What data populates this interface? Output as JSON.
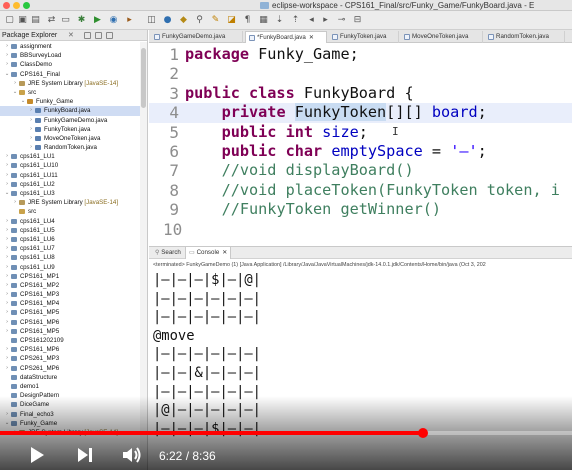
{
  "window": {
    "title": "eclipse-workspace - CPS161_Final/src/Funky_Game/FunkyBoard.java - E"
  },
  "colors": {
    "keyword": "#7f0055",
    "comment": "#3f7f5f",
    "string": "#2a00ff",
    "field": "#0000c0",
    "progress": "#ff0000",
    "selection": "#cfdcf3"
  },
  "explorer": {
    "tab_label": "Package Explorer",
    "close_icon": "✕",
    "items": [
      {
        "label": "assignment",
        "depth": 0,
        "arrow": "›",
        "icon": "project-icon"
      },
      {
        "label": "BBSurveyLoad",
        "depth": 0,
        "arrow": "›",
        "icon": "project-icon"
      },
      {
        "label": "ClassDemo",
        "depth": 0,
        "arrow": "›",
        "icon": "project-icon"
      },
      {
        "label": "CPS161_Final",
        "depth": 0,
        "arrow": "⌄",
        "icon": "project-icon"
      },
      {
        "label": "JRE System Library",
        "deco": "[JavaSE-14]",
        "depth": 1,
        "arrow": "›",
        "icon": "library-icon"
      },
      {
        "label": "src",
        "depth": 1,
        "arrow": "⌄",
        "icon": "source-folder-icon"
      },
      {
        "label": "Funky_Game",
        "depth": 2,
        "arrow": "⌄",
        "icon": "package-icon"
      },
      {
        "label": "FunkyBoard.java",
        "depth": 3,
        "arrow": "›",
        "icon": "java-file-icon",
        "selected": true
      },
      {
        "label": "FunkyGameDemo.java",
        "depth": 3,
        "arrow": "›",
        "icon": "java-file-icon"
      },
      {
        "label": "FunkyToken.java",
        "depth": 3,
        "arrow": "›",
        "icon": "java-file-icon"
      },
      {
        "label": "MoveOneToken.java",
        "depth": 3,
        "arrow": "›",
        "icon": "java-file-icon"
      },
      {
        "label": "RandomToken.java",
        "depth": 3,
        "arrow": "›",
        "icon": "java-file-icon"
      },
      {
        "label": "cps161_LU1",
        "depth": 0,
        "arrow": "›",
        "icon": "project-icon"
      },
      {
        "label": "cps161_LU10",
        "depth": 0,
        "arrow": "›",
        "icon": "project-icon"
      },
      {
        "label": "cps161_LU11",
        "depth": 0,
        "arrow": "›",
        "icon": "project-icon"
      },
      {
        "label": "cps161_LU2",
        "depth": 0,
        "arrow": "›",
        "icon": "project-icon"
      },
      {
        "label": "cps161_LU3",
        "depth": 0,
        "arrow": "⌄",
        "icon": "project-icon"
      },
      {
        "label": "JRE System Library",
        "deco": "[JavaSE-14]",
        "depth": 1,
        "arrow": "›",
        "icon": "library-icon"
      },
      {
        "label": "src",
        "depth": 1,
        "arrow": "",
        "icon": "source-folder-icon"
      },
      {
        "label": "cps161_LU4",
        "depth": 0,
        "arrow": "›",
        "icon": "project-icon"
      },
      {
        "label": "cps161_LU5",
        "depth": 0,
        "arrow": "›",
        "icon": "project-icon"
      },
      {
        "label": "cps161_LU6",
        "depth": 0,
        "arrow": "›",
        "icon": "project-icon"
      },
      {
        "label": "cps161_LU7",
        "depth": 0,
        "arrow": "›",
        "icon": "project-icon"
      },
      {
        "label": "cps161_LU8",
        "depth": 0,
        "arrow": "›",
        "icon": "project-icon"
      },
      {
        "label": "cps161_LU9",
        "depth": 0,
        "arrow": "›",
        "icon": "project-icon"
      },
      {
        "label": "CPS161_MP1",
        "depth": 0,
        "arrow": "›",
        "icon": "project-icon"
      },
      {
        "label": "CPS161_MP2",
        "depth": 0,
        "arrow": "›",
        "icon": "project-icon"
      },
      {
        "label": "CPS161_MP3",
        "depth": 0,
        "arrow": "›",
        "icon": "project-icon"
      },
      {
        "label": "CPS161_MP4",
        "depth": 0,
        "arrow": "›",
        "icon": "project-icon"
      },
      {
        "label": "CPS161_MP5",
        "depth": 0,
        "arrow": "›",
        "icon": "project-icon"
      },
      {
        "label": "CPS161_MP6",
        "depth": 0,
        "arrow": "›",
        "icon": "project-icon"
      },
      {
        "label": "CPS161_MP5",
        "depth": 0,
        "arrow": "›",
        "icon": "project-icon"
      },
      {
        "label": "CPS161202109",
        "depth": 0,
        "arrow": "",
        "icon": "project-icon"
      },
      {
        "label": "CPS161_MP6",
        "depth": 0,
        "arrow": "›",
        "icon": "project-icon"
      },
      {
        "label": "CPS261_MP3",
        "depth": 0,
        "arrow": "›",
        "icon": "project-icon"
      },
      {
        "label": "CPS261_MP6",
        "depth": 0,
        "arrow": "›",
        "icon": "project-icon"
      },
      {
        "label": "dataStructure",
        "depth": 0,
        "arrow": "",
        "icon": "project-icon"
      },
      {
        "label": "demo1",
        "depth": 0,
        "arrow": "",
        "icon": "project-icon"
      },
      {
        "label": "DesignPattern",
        "depth": 0,
        "arrow": "",
        "icon": "project-icon"
      },
      {
        "label": "DiceGame",
        "depth": 0,
        "arrow": "",
        "icon": "project-icon"
      },
      {
        "label": "Final_echo3",
        "depth": 0,
        "arrow": "›",
        "icon": "project-icon"
      },
      {
        "label": "Funky_Game",
        "depth": 0,
        "arrow": "⌄",
        "icon": "project-icon"
      },
      {
        "label": "JRE System Library",
        "deco": "[JavaSE-14]",
        "depth": 1,
        "arrow": "›",
        "icon": "library-icon"
      }
    ]
  },
  "editor": {
    "tabs": [
      {
        "label": "FunkyGameDemo.java",
        "active": false
      },
      {
        "label": "*FunkyBoard.java",
        "close": "✕",
        "active": true
      },
      {
        "label": "FunkyToken.java",
        "active": false
      },
      {
        "label": "MoveOneToken.java",
        "active": false
      },
      {
        "label": "RandomToken.java",
        "active": false
      }
    ],
    "lines": [
      {
        "num": "1",
        "segments": [
          {
            "t": "package ",
            "c": "kw"
          },
          {
            "t": "Funky_Game;",
            "c": ""
          }
        ]
      },
      {
        "num": "2",
        "segments": []
      },
      {
        "num": "3",
        "segments": [
          {
            "t": "public class ",
            "c": "kw"
          },
          {
            "t": "FunkyBoard {",
            "c": ""
          }
        ]
      },
      {
        "num": "4",
        "current": true,
        "segments": [
          {
            "t": "    ",
            "c": ""
          },
          {
            "t": "private ",
            "c": "kw"
          },
          {
            "t": "FunkyToken",
            "c": "hl"
          },
          {
            "t": "[][] ",
            "c": ""
          },
          {
            "t": "board",
            "c": "field"
          },
          {
            "t": ";",
            "c": ""
          }
        ]
      },
      {
        "num": "5",
        "segments": [
          {
            "t": "    ",
            "c": ""
          },
          {
            "t": "public int ",
            "c": "kw"
          },
          {
            "t": "size",
            "c": "field"
          },
          {
            "t": ";",
            "c": ""
          }
        ]
      },
      {
        "num": "6",
        "segments": [
          {
            "t": "    ",
            "c": ""
          },
          {
            "t": "public char ",
            "c": "kw"
          },
          {
            "t": "emptySpace",
            "c": "field"
          },
          {
            "t": " = ",
            "c": ""
          },
          {
            "t": "'—'",
            "c": "str"
          },
          {
            "t": ";",
            "c": ""
          }
        ]
      },
      {
        "num": "7",
        "segments": [
          {
            "t": "    ",
            "c": ""
          },
          {
            "t": "//void displayBoard()",
            "c": "cm"
          }
        ]
      },
      {
        "num": "8",
        "segments": [
          {
            "t": "    ",
            "c": ""
          },
          {
            "t": "//void placeToken(FunkyToken token, i",
            "c": "cm"
          }
        ]
      },
      {
        "num": "9",
        "segments": [
          {
            "t": "    ",
            "c": ""
          },
          {
            "t": "//FunkyToken getWinner()",
            "c": "cm"
          }
        ]
      },
      {
        "num": "10",
        "segments": []
      }
    ],
    "text_cursor": "I"
  },
  "console": {
    "tabs": [
      {
        "label": "Search",
        "active": false
      },
      {
        "label": "Console",
        "close": "✕",
        "active": true
      }
    ],
    "path": "<terminated> FunkyGameDemo (1) [Java Application] /Library/Java/JavaVirtualMachines/jdk-14.0.1.jdk/Contents/Home/bin/java  (Oct 3, 202",
    "output": [
      "|—|—|—|$|—|@|",
      "|—|—|—|—|—|—|",
      "|—|—|—|—|—|—|",
      "@move",
      "|—|—|—|—|—|—|",
      "|—|—|&|—|—|—|",
      "|—|—|—|—|—|—|",
      "|@|—|—|—|—|—|",
      "|—|—|—|$|—|—|"
    ]
  },
  "video": {
    "current_time": "6:22",
    "duration": "8:36",
    "time_display": "6:22 / 8:36",
    "progress": 0.74
  }
}
